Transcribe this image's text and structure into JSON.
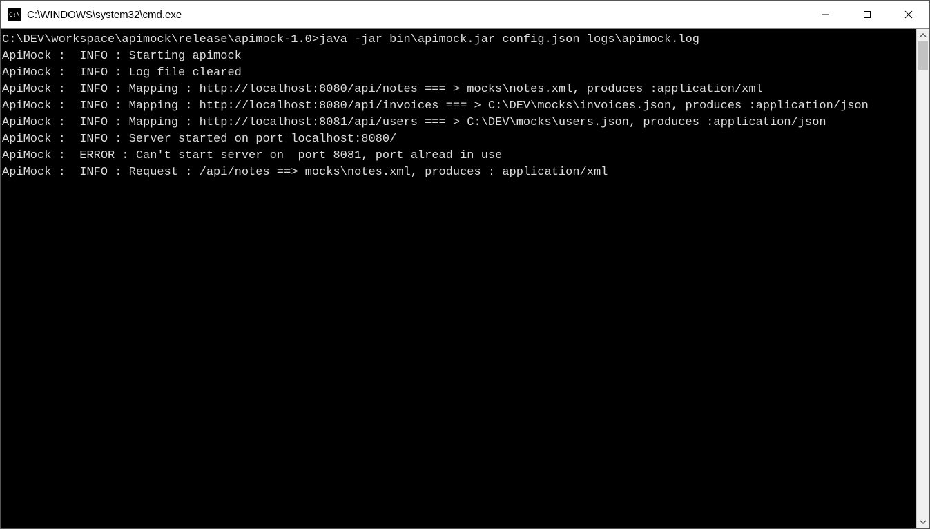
{
  "window": {
    "title": "C:\\WINDOWS\\system32\\cmd.exe"
  },
  "prompt": {
    "cwd": "C:\\DEV\\workspace\\apimock\\release\\apimock-1.0>",
    "command": "java -jar bin\\apimock.jar config.json logs\\apimock.log"
  },
  "log": {
    "l1": "ApiMock :  INFO : Starting apimock",
    "l2": "ApiMock :  INFO : Log file cleared",
    "l3": "ApiMock :  INFO : Mapping : http://localhost:8080/api/notes === > mocks\\notes.xml, produces :application/xml",
    "l4": "ApiMock :  INFO : Mapping : http://localhost:8080/api/invoices === > C:\\DEV\\mocks\\invoices.json, produces :application/json",
    "l5": "ApiMock :  INFO : Mapping : http://localhost:8081/api/users === > C:\\DEV\\mocks\\users.json, produces :application/json",
    "l6": "ApiMock :  INFO : Server started on port localhost:8080/",
    "l7": "ApiMock :  ERROR : Can't start server on  port 8081, port alread in use",
    "l8": "ApiMock :  INFO : Request : /api/notes ==> mocks\\notes.xml, produces : application/xml"
  }
}
